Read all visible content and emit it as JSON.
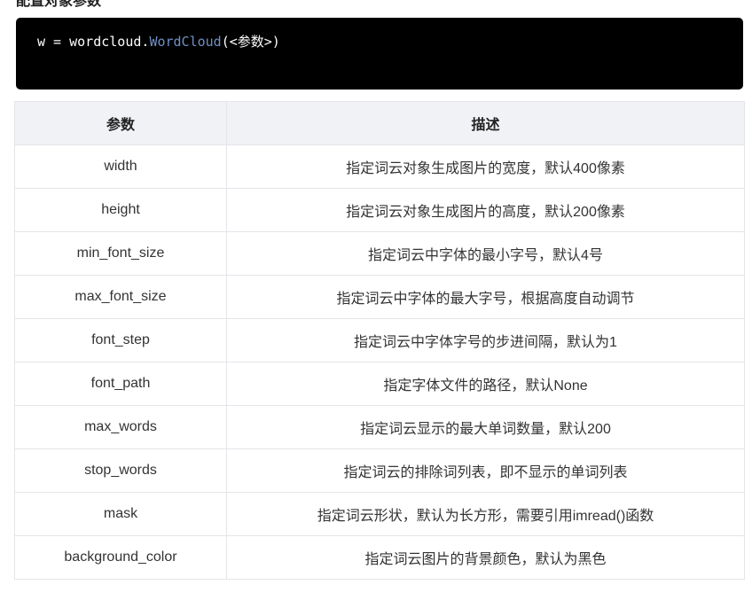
{
  "heading": "配置对象参数",
  "code": {
    "prefix": "w = wordcloud.",
    "function": "WordCloud",
    "suffix": "(<参数>)"
  },
  "table": {
    "headers": [
      "参数",
      "描述"
    ],
    "rows": [
      {
        "param": "width",
        "desc": "指定词云对象生成图片的宽度，默认400像素"
      },
      {
        "param": "height",
        "desc": "指定词云对象生成图片的高度，默认200像素"
      },
      {
        "param": "min_font_size",
        "desc": "指定词云中字体的最小字号，默认4号"
      },
      {
        "param": "max_font_size",
        "desc": "指定词云中字体的最大字号，根据高度自动调节"
      },
      {
        "param": "font_step",
        "desc": "指定词云中字体字号的步进间隔，默认为1"
      },
      {
        "param": "font_path",
        "desc": "指定字体文件的路径，默认None"
      },
      {
        "param": "max_words",
        "desc": "指定词云显示的最大单词数量，默认200"
      },
      {
        "param": "stop_words",
        "desc": "指定词云的排除词列表，即不显示的单词列表"
      },
      {
        "param": "mask",
        "desc": "指定词云形状，默认为长方形，需要引用imread()函数"
      },
      {
        "param": "background_color",
        "desc": "指定词云图片的背景颜色，默认为黑色"
      }
    ]
  }
}
